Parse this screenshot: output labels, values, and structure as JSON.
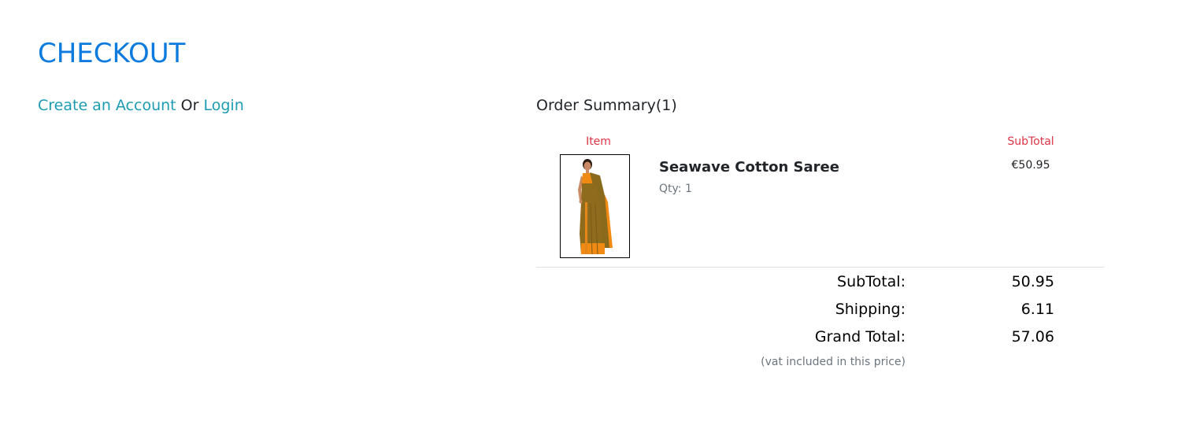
{
  "page": {
    "title": "CHECKOUT"
  },
  "account": {
    "create_label": "Create an Account",
    "or_label": "Or",
    "login_label": "Login"
  },
  "summary": {
    "heading": "Order Summary(1)",
    "item_header": "Item",
    "subtotal_header": "SubTotal",
    "items": [
      {
        "name": "Seawave Cotton Saree",
        "qty_label": "Qty: 1",
        "price": "€50.95",
        "image": "saree-product-image"
      }
    ],
    "totals": {
      "subtotal_label": "SubTotal:",
      "subtotal_value": "50.95",
      "shipping_label": "Shipping:",
      "shipping_value": "6.11",
      "grand_label": "Grand Total:",
      "grand_value": "57.06",
      "vat_note": "(vat included in this price)"
    }
  },
  "colors": {
    "title": "#0d7bde",
    "link": "#1d9bb3",
    "column_header": "#dc3545",
    "muted": "#6c757d"
  }
}
